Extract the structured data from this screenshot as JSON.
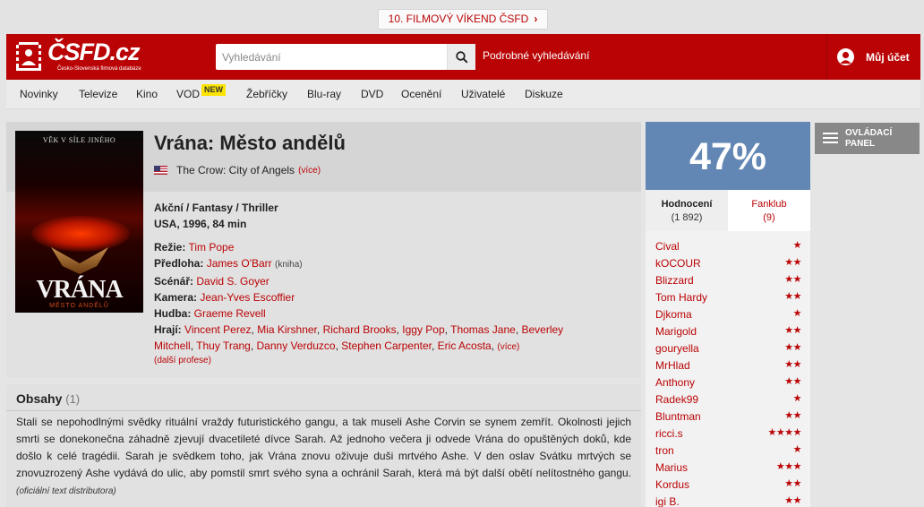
{
  "promo": {
    "label": "10. FILMOVÝ VÍKEND ČSFD"
  },
  "header": {
    "logo_text": "ČSFD.cz",
    "logo_tagline": "Česko-Slovenská filmová databáze",
    "search_placeholder": "Vyhledávání",
    "advanced_search": "Podrobné vyhledávání",
    "account": "Můj účet"
  },
  "nav": {
    "items": [
      "Novinky",
      "Televize",
      "Kino",
      "VOD",
      "Žebříčky",
      "Blu-ray",
      "DVD",
      "Ocenění",
      "Uživatelé",
      "Diskuze"
    ],
    "new_badge": "NEW"
  },
  "film": {
    "poster": {
      "tagline": "VĚK V SÍLE JINÉHO",
      "title": "VRÁNA",
      "subtitle": "MĚSTO ANDĚLŮ"
    },
    "title": "Vrána: Město andělů",
    "original_title": "The Crow: City of Angels",
    "more": "(více)",
    "genres": "Akční / Fantasy / Thriller",
    "origin": "USA, 1996, 84 min",
    "creators": {
      "director_label": "Režie:",
      "director": "Tim Pope",
      "source_label": "Předloha:",
      "source": "James O'Barr",
      "source_note": "(kniha)",
      "writer_label": "Scénář:",
      "writer": "David S. Goyer",
      "camera_label": "Kamera:",
      "camera": "Jean-Yves Escoffier",
      "music_label": "Hudba:",
      "music": "Graeme Revell",
      "cast_label": "Hrají:",
      "cast": [
        "Vincent Perez",
        "Mia Kirshner",
        "Richard Brooks",
        "Iggy Pop",
        "Thomas Jane",
        "Beverley Mitchell",
        "Thuy Trang",
        "Danny Verduzco",
        "Stephen Carpenter",
        "Eric Acosta"
      ],
      "cast_more": "(více)"
    },
    "more_professions": "(další profese)"
  },
  "plot": {
    "title": "Obsahy",
    "count": "(1)",
    "text": "Stali se nepohodlnými svědky rituální vraždy futuristického gangu, a tak museli Ashe Corvin se synem zemřít. Okolnosti jejich smrti se donekonečna záhadně zjevují dvacetileté dívce Sarah. Až jednoho večera ji odvede Vrána do opuštěných doků, kde došlo k celé tragédii. Sarah je svědkem toho, jak Vrána znovu oživuje duši mrtvého Ashe. V den oslav Svátku mrtvých se znovuzrozený Ashe vydává do ulic, aby pomstil smrt svého syna a ochránil Sarah, která má být další obětí nelítostného gangu.",
    "source": "(oficiální text distributora)"
  },
  "rating": {
    "score": "47%",
    "score_color": "#6287b4",
    "tabs": [
      {
        "label": "Hodnocení",
        "count": "(1 892)"
      },
      {
        "label": "Fanklub",
        "count": "(9)"
      }
    ],
    "users": [
      {
        "name": "Cival",
        "stars": "★"
      },
      {
        "name": "kOCOUR",
        "stars": "★★"
      },
      {
        "name": "Blizzard",
        "stars": "★★"
      },
      {
        "name": "Tom Hardy",
        "stars": "★★"
      },
      {
        "name": "Djkoma",
        "stars": "★"
      },
      {
        "name": "Marigold",
        "stars": "★★"
      },
      {
        "name": "gouryella",
        "stars": "★★"
      },
      {
        "name": "MrHlad",
        "stars": "★★"
      },
      {
        "name": "Anthony",
        "stars": "★★"
      },
      {
        "name": "Radek99",
        "stars": "★"
      },
      {
        "name": "Bluntman",
        "stars": "★★"
      },
      {
        "name": "ricci.s",
        "stars": "★★★★"
      },
      {
        "name": "tron",
        "stars": "★"
      },
      {
        "name": "Marius",
        "stars": "★★★"
      },
      {
        "name": "Kordus",
        "stars": "★★"
      },
      {
        "name": "igi B.",
        "stars": "★★"
      }
    ]
  },
  "panel": {
    "label": "OVLÁDACÍ PANEL"
  },
  "colors": {
    "brand_red": "#ba0305",
    "rating_blue": "#6287b4",
    "badge_yellow": "#fce400"
  }
}
